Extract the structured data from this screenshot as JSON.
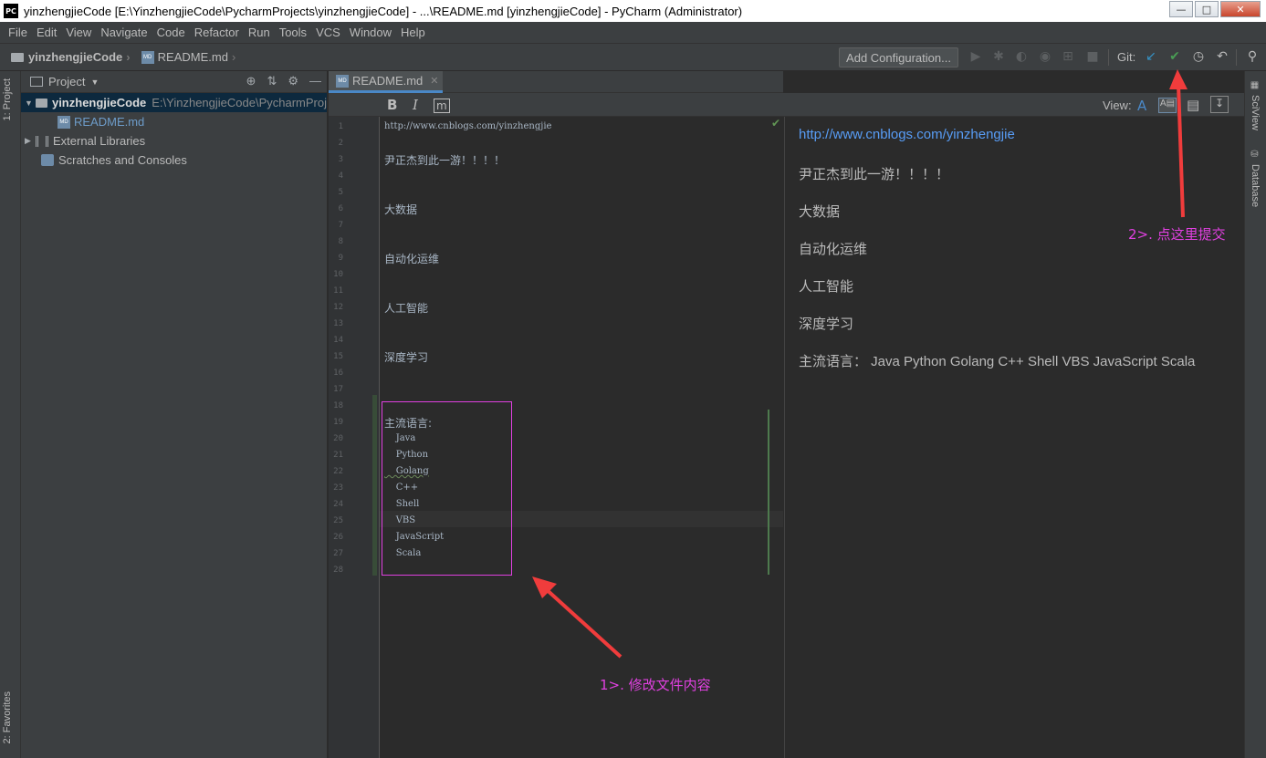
{
  "window": {
    "app_icon": "PC",
    "title": "yinzhengjieCode [E:\\YinzhengjieCode\\PycharmProjects\\yinzhengjieCode] - ...\\README.md [yinzhengjieCode] - PyCharm (Administrator)",
    "controls": [
      "minimize-icon",
      "maximize-icon",
      "close-icon"
    ]
  },
  "menu": [
    "File",
    "Edit",
    "View",
    "Navigate",
    "Code",
    "Refactor",
    "Run",
    "Tools",
    "VCS",
    "Window",
    "Help"
  ],
  "navbar": {
    "project": "yinzhengjieCode",
    "file": "README.md",
    "add_configuration": "Add Configuration...",
    "git_label": "Git:",
    "git_update_color": "#3592c4",
    "git_commit_color": "#499c54"
  },
  "left_tabs": {
    "project": "1: Project",
    "favorites": "2: Favorites"
  },
  "project_panel": {
    "title": "Project",
    "tree": [
      {
        "label": "yinzhengjieCode",
        "path": "E:\\YinzhengjieCode\\PycharmProj",
        "expanded": true,
        "selected": true
      },
      {
        "label": "README.md"
      },
      {
        "label": "External Libraries",
        "expanded": false
      },
      {
        "label": "Scratches and Consoles"
      }
    ]
  },
  "editor": {
    "tab_label": "README.md",
    "toolbar": {
      "bold": "B",
      "italic": "I",
      "view_label": "View:"
    },
    "line_numbers": [
      "1",
      "2",
      "3",
      "4",
      "5",
      "6",
      "7",
      "8",
      "9",
      "10",
      "11",
      "12",
      "13",
      "14",
      "15",
      "16",
      "17",
      "18",
      "19",
      "20",
      "21",
      "22",
      "23",
      "24",
      "25",
      "26",
      "27",
      "28"
    ],
    "lines": [
      "http://www.cnblogs.com/yinzhengjie",
      "",
      "尹正杰到此一游！！！！",
      "",
      "",
      "大数据",
      "",
      "",
      "自动化运维",
      "",
      "",
      "人工智能",
      "",
      "",
      "深度学习",
      "",
      "",
      "",
      "主流语言:",
      "    Java",
      "    Python",
      "    Golang",
      "    C++",
      "    Shell",
      "    VBS",
      "    JavaScript",
      "    Scala",
      ""
    ]
  },
  "preview": {
    "link": "http://www.cnblogs.com/yinzhengjie",
    "paragraphs": [
      "尹正杰到此一游！！！！",
      "大数据",
      "自动化运维",
      "人工智能",
      "深度学习",
      "主流语言： Java Python Golang C++ Shell VBS JavaScript Scala"
    ]
  },
  "right_tabs": {
    "sciview": "SciView",
    "database": "Database"
  },
  "annotations": {
    "step1": "1>. 修改文件内容",
    "step2": "2>. 点这里提交",
    "color": "#e040e0",
    "arrow_color": "#f03c3c"
  }
}
